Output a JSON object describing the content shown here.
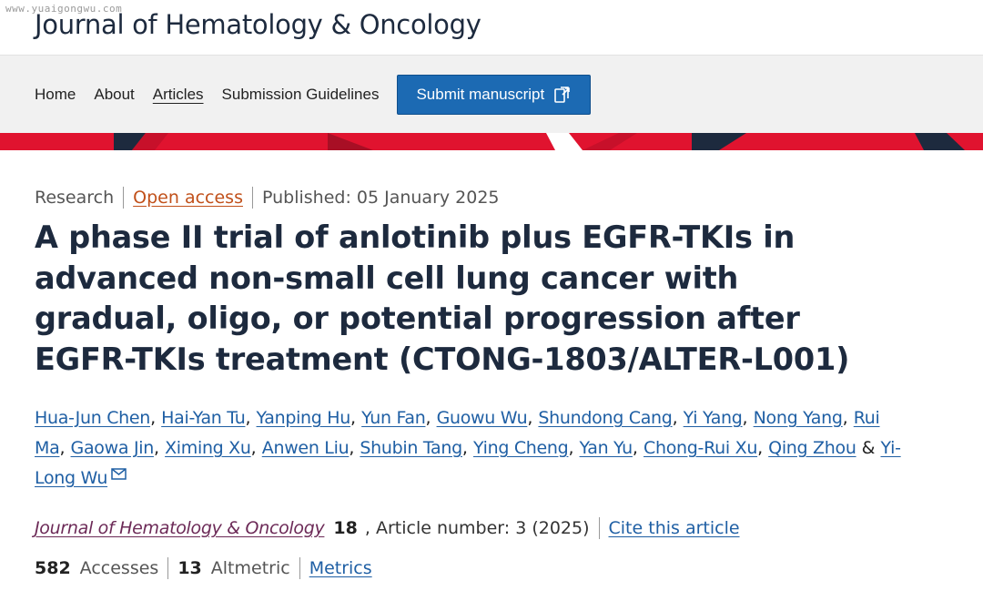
{
  "watermark": "www.yuaigongwu.com",
  "site": {
    "journal_title": "Journal of Hematology & Oncology"
  },
  "nav": {
    "items": [
      {
        "label": "Home"
      },
      {
        "label": "About"
      },
      {
        "label": "Articles",
        "current": true
      },
      {
        "label": "Submission Guidelines"
      }
    ],
    "submit_label": "Submit manuscript"
  },
  "colors": {
    "brand_navy": "#1d2a3e",
    "banner_red": "#e0132f",
    "button_blue": "#1c6ab3",
    "link_blue": "#1f5fa4",
    "open_access_orange": "#c1501a"
  },
  "article": {
    "type": "Research",
    "access": "Open access",
    "published": "Published: 05 January 2025",
    "title": "A phase II trial of anlotinib plus EGFR-TKIs in advanced non-small cell lung cancer with gradual, oligo, or potential progression after EGFR-TKIs treatment (CTONG-1803/ALTER-L001)",
    "authors": [
      "Hua-Jun Chen",
      "Hai-Yan Tu",
      "Yanping Hu",
      "Yun Fan",
      "Guowu Wu",
      "Shundong Cang",
      "Yi Yang",
      "Nong Yang",
      "Rui Ma",
      "Gaowa Jin",
      "Ximing Xu",
      "Anwen Liu",
      "Shubin Tang",
      "Ying Cheng",
      "Yan Yu",
      "Chong-Rui Xu",
      "Qing Zhou",
      "Yi-Long Wu"
    ],
    "author_separator": ", ",
    "author_last_separator": " & ",
    "citation": {
      "journal": "Journal of Hematology & Oncology",
      "volume": "18",
      "article_number": ", Article number: 3 (2025)",
      "cite_label": "Cite this article"
    },
    "metrics": {
      "accesses_count": "582",
      "accesses_label": "Accesses",
      "altmetric_count": "13",
      "altmetric_label": "Altmetric",
      "metrics_link": "Metrics"
    }
  }
}
